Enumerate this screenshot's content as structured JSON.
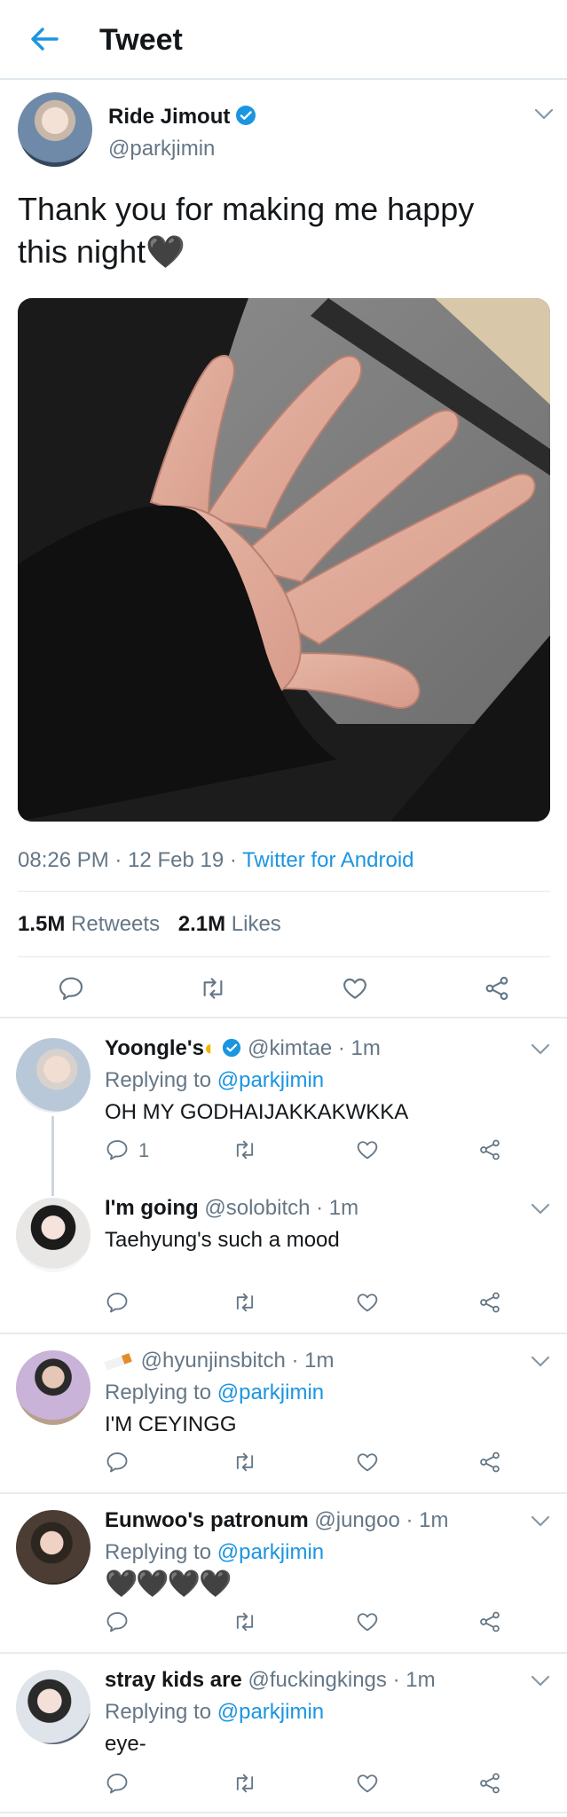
{
  "header": {
    "title": "Tweet"
  },
  "tweet": {
    "display_name": "Ride Jimout",
    "handle": "@parkjimin",
    "text_line1": "Thank you for making me happy",
    "text_line2": "this night",
    "emoji": "🖤",
    "time": "08:26 PM",
    "date": "12 Feb 19",
    "source": "Twitter for Android",
    "sep": "·",
    "retweets_count": "1.5M",
    "retweets_label": "Retweets",
    "likes_count": "2.1M",
    "likes_label": "Likes"
  },
  "replies": [
    {
      "name": "Yoongle's",
      "badge": "◐",
      "handle": "@kimtae",
      "time": "· 1m",
      "replying_label": "Replying to",
      "replying_to": "@parkjimin",
      "text": "OH MY GODHAIJAKKAKWKKA",
      "reply_count": "1"
    },
    {
      "name": "I'm going",
      "handle": "@solobitch",
      "time": "· 1m",
      "text": "Taehyung's such a mood"
    },
    {
      "name": "",
      "handle": "@hyunjinsbitch",
      "time": "· 1m",
      "replying_label": "Replying to",
      "replying_to": "@parkjimin",
      "text": "I'M CEYINGG"
    },
    {
      "name": "Eunwoo's patronum",
      "handle": "@jungoo",
      "time": "· 1m",
      "replying_label": "Replying to",
      "replying_to": "@parkjimin",
      "hearts": [
        "🖤",
        "🖤",
        "🖤",
        "🖤"
      ]
    },
    {
      "name": "stray kids are",
      "handle": "@fuckingkings",
      "time": "· 1m",
      "replying_label": "Replying to",
      "replying_to": "@parkjimin",
      "text": "eye-"
    }
  ],
  "icons": {
    "back": "back-arrow-icon",
    "reply": "reply-icon",
    "retweet": "retweet-icon",
    "like": "heart-icon",
    "share": "share-icon",
    "verified": "verified-badge-icon",
    "more": "chevron-down-icon"
  },
  "colors": {
    "accent": "#1b95e0",
    "text": "#14171a",
    "muted": "#657786",
    "border": "#e1e8ed"
  }
}
